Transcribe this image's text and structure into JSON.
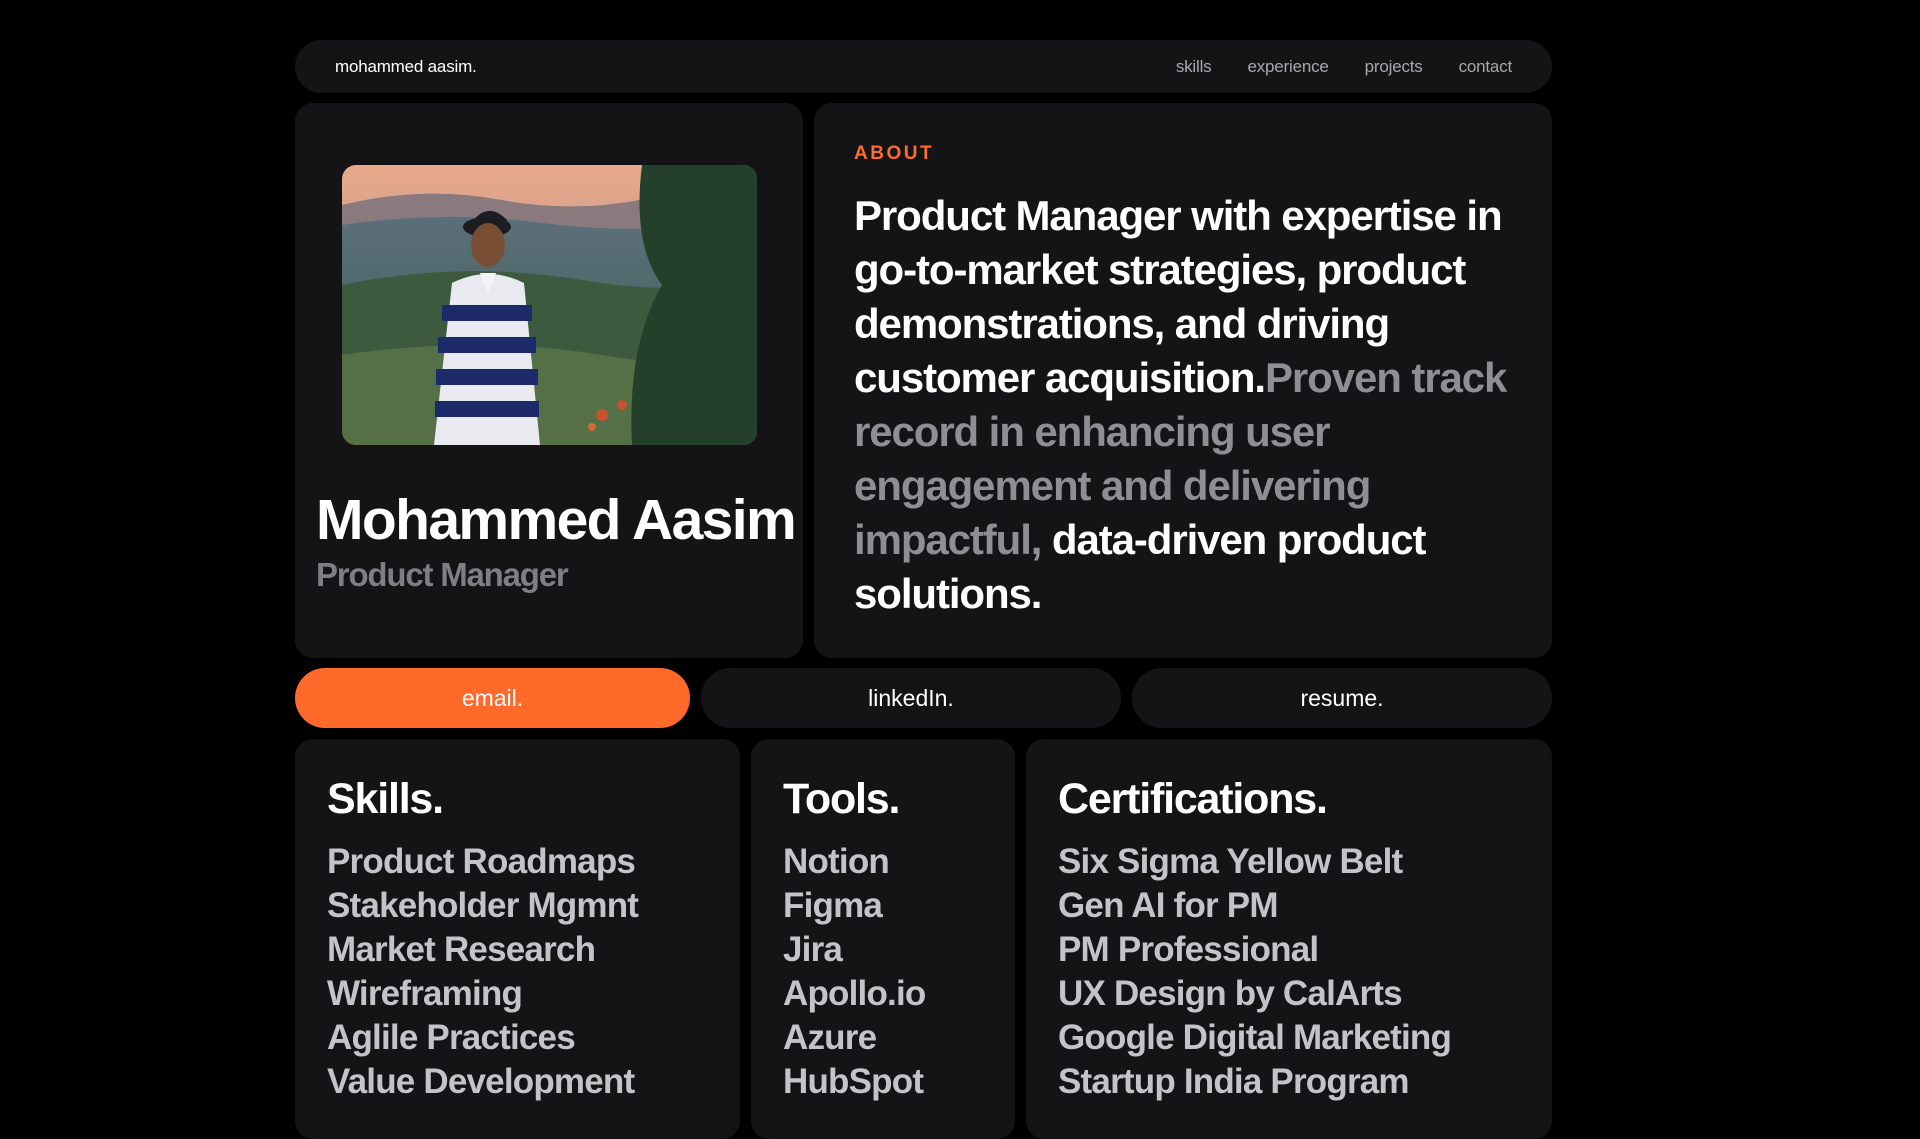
{
  "nav": {
    "brand": "mohammed aasim.",
    "links": [
      "skills",
      "experience",
      "projects",
      "contact"
    ]
  },
  "profile": {
    "name": "Mohammed Aasim",
    "role": "Product Manager"
  },
  "about": {
    "label": "ABOUT",
    "text_part1": "Product Manager with expertise in go-to-market strategies, product demonstrations, and driving customer acquisition.",
    "text_part2": "Proven track record in enhancing user engagement and delivering impactful,",
    "text_part3": " data-driven product solutions."
  },
  "buttons": {
    "email": "email.",
    "linkedin": "linkedIn.",
    "resume": "resume."
  },
  "skills": {
    "title": "Skills.",
    "items": [
      "Product Roadmaps",
      "Stakeholder Mgmnt",
      "Market Research",
      "Wireframing",
      "Aglile Practices",
      "Value Development"
    ]
  },
  "tools": {
    "title": "Tools.",
    "items": [
      "Notion",
      "Figma",
      "Jira",
      "Apollo.io",
      "Azure",
      "HubSpot"
    ]
  },
  "certifications": {
    "title": "Certifications.",
    "items": [
      "Six Sigma Yellow Belt",
      "Gen AI for PM",
      "PM Professional",
      "UX Design by CalArts",
      "Google Digital Marketing",
      "Startup India Program"
    ]
  },
  "colors": {
    "accent": "#ff6a2a",
    "card_bg": "#141416",
    "page_bg": "#000000",
    "muted_text": "#8e8e93"
  }
}
